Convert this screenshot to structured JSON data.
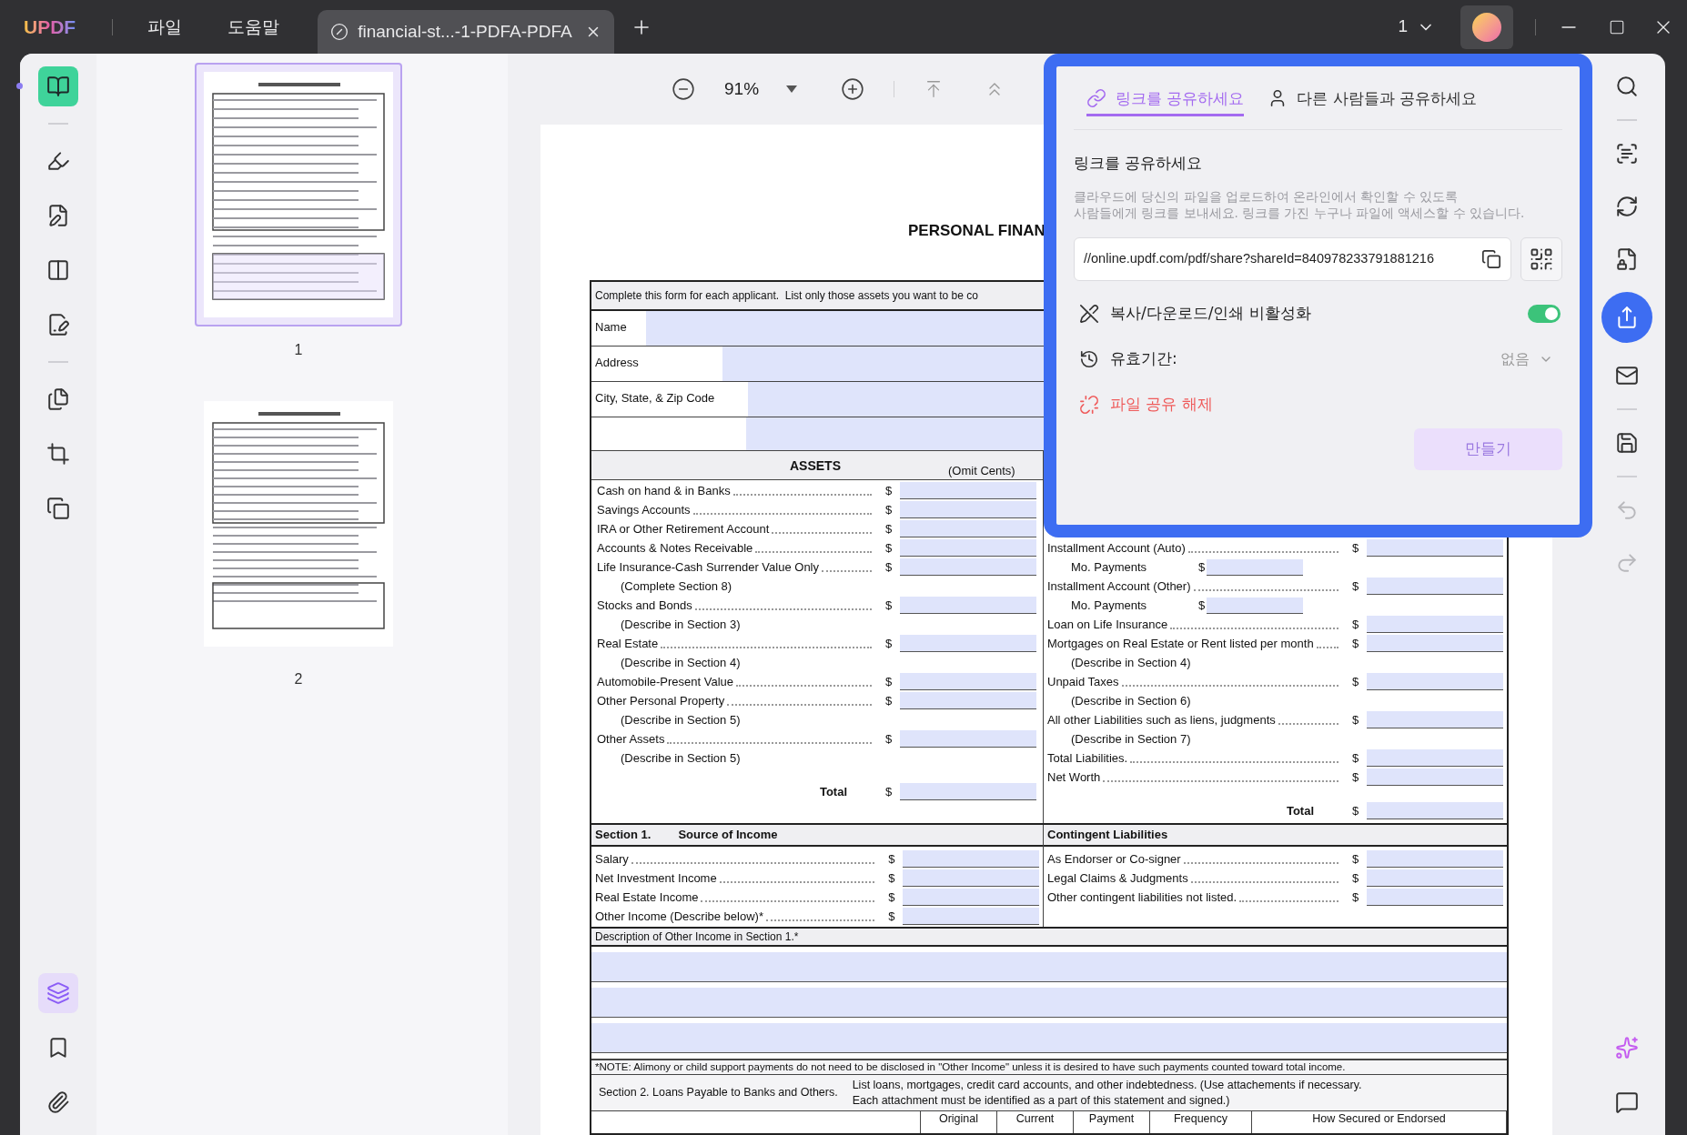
{
  "app": {
    "logo": "UPDF",
    "menus": [
      "파일",
      "도움말"
    ]
  },
  "document_tab": {
    "title": "financial-st...-1-PDFA-PDFA",
    "selected": true
  },
  "page_indicator": "1",
  "left_tool_groups": [
    [
      {
        "kind": "read",
        "selected": true
      }
    ],
    [
      {
        "kind": "comment",
        "selected": false
      },
      {
        "kind": "edit",
        "selected": false
      },
      {
        "kind": "organize",
        "selected": false
      },
      {
        "kind": "sign",
        "selected": false
      }
    ],
    [
      {
        "kind": "pages",
        "selected": false
      },
      {
        "kind": "crop",
        "selected": false
      },
      {
        "kind": "copy",
        "selected": false
      }
    ]
  ],
  "left_bottom_tools": [
    {
      "kind": "layers",
      "selected": true
    },
    {
      "kind": "bookmark",
      "selected": false
    },
    {
      "kind": "attachment",
      "selected": false
    }
  ],
  "thumbnails": [
    {
      "label": "1",
      "selected": true
    },
    {
      "label": "2",
      "selected": false
    }
  ],
  "toolbar": {
    "zoom": "91%"
  },
  "form": {
    "title": "PERSONAL FINAN",
    "intro": "Complete this form for each applicant.  List only those assets you want to be co",
    "identity_rows": [
      {
        "label": "Name"
      },
      {
        "label": "Address"
      },
      {
        "label": "City, State, & Zip Code"
      }
    ],
    "assets_header": "ASSETS",
    "omit_note": "(Omit Cents)",
    "assets": [
      {
        "kind": "line",
        "label": "Cash on hand & in Banks",
        "currency": "$"
      },
      {
        "kind": "line",
        "label": "Savings Accounts",
        "currency": "$"
      },
      {
        "kind": "line",
        "label": "IRA or Other Retirement Account",
        "currency": "$"
      },
      {
        "kind": "line",
        "label": "Accounts & Notes Receivable",
        "currency": "$"
      },
      {
        "kind": "line",
        "label": "Life Insurance-Cash Surrender Value Only",
        "sub": "(Complete Section 8)",
        "currency": "$"
      },
      {
        "kind": "line",
        "label": "Stocks and Bonds",
        "sub": "(Describe in Section 3)",
        "currency": "$"
      },
      {
        "kind": "line",
        "label": "Real Estate",
        "sub": "(Describe in Section 4)",
        "currency": "$"
      },
      {
        "kind": "line",
        "label": "Automobile-Present Value",
        "currency": "$"
      },
      {
        "kind": "line",
        "label": "Other Personal Property",
        "sub": "(Describe in Section 5)",
        "currency": "$"
      },
      {
        "kind": "line",
        "label": "Other Assets",
        "sub": "(Describe in Section 5)",
        "currency": "$"
      },
      {
        "kind": "total",
        "label": "Total",
        "currency": "$"
      }
    ],
    "liabilities": [
      {
        "kind": "line",
        "label": "Installment Account (Auto)",
        "currency": "$"
      },
      {
        "kind": "payment",
        "label": "Mo. Payments",
        "currency": "$"
      },
      {
        "kind": "line",
        "label": "Installment Account (Other)",
        "currency": "$"
      },
      {
        "kind": "payment",
        "label": "Mo. Payments",
        "currency": "$"
      },
      {
        "kind": "line",
        "label": "Loan on Life Insurance",
        "currency": "$"
      },
      {
        "kind": "line",
        "label": "Mortgages on Real Estate or Rent listed per month",
        "sub": "(Describe in Section 4)",
        "currency": "$"
      },
      {
        "kind": "line",
        "label": "Unpaid Taxes",
        "sub": "(Describe in Section 6)",
        "currency": "$"
      },
      {
        "kind": "line",
        "label": "All other Liabilities such as liens, judgments",
        "sub": "(Describe in Section 7)",
        "currency": "$"
      },
      {
        "kind": "line",
        "label": "Total Liabilities.",
        "currency": "$"
      },
      {
        "kind": "line",
        "label": "Net Worth",
        "currency": "$"
      },
      {
        "kind": "total",
        "label": "Total",
        "currency": "$"
      }
    ],
    "income_header": {
      "number": "Section 1.",
      "title": "Source of Income"
    },
    "income": [
      {
        "kind": "line",
        "label": "Salary",
        "currency": "$"
      },
      {
        "kind": "line",
        "label": "Net Investment Income",
        "currency": "$"
      },
      {
        "kind": "line",
        "label": "Real Estate Income",
        "currency": "$"
      },
      {
        "kind": "line",
        "label": "Other Income (Describe below)*",
        "currency": "$"
      }
    ],
    "contingent_header": "Contingent Liabilities",
    "contingent": [
      {
        "kind": "line",
        "label": "As Endorser or Co-signer",
        "currency": "$"
      },
      {
        "kind": "line",
        "label": "Legal Claims & Judgments",
        "currency": "$"
      },
      {
        "kind": "line",
        "label": "Other contingent liabilities not listed.",
        "currency": "$"
      }
    ],
    "description_label": "Description of Other Income in Section 1.*",
    "note": "*NOTE: Alimony or child support payments do not need to be disclosed in \"Other Income\" unless it is desired to have such payments counted toward total income.",
    "section2": {
      "title": "Section 2. Loans Payable to Banks and Others.",
      "lines": [
        "List loans, mortgages, credit card accounts, and other indebtedness. (Use attachements if necessary.",
        "Each attachment must be identified as a part of this statement and signed.)"
      ]
    },
    "loan_columns": [
      "Original",
      "Current",
      "Payment",
      "Frequency",
      "How Secured or Endorsed"
    ]
  },
  "share_dialog": {
    "tabs": [
      {
        "label": "링크를 공유하세요",
        "kind": "link",
        "selected": true
      },
      {
        "label": "다른 사람들과 공유하세요",
        "kind": "people",
        "selected": false
      }
    ],
    "heading": "링크를 공유하세요",
    "description_lines": [
      "클라우드에 당신의 파일을 업로드하여 온라인에서 확인할 수 있도록",
      "사람들에게 링크를 보내세요. 링크를 가진 누구나 파일에 액세스할 수 있습니다."
    ],
    "link": "//online.updf.com/pdf/share?shareId=840978233791881216",
    "restrict": {
      "label": "복사/다운로드/인쇄 비활성화",
      "on": true
    },
    "expiry": {
      "label": "유효기간:",
      "value": "없음"
    },
    "unshare": "파일 공유 해제",
    "create": {
      "label": "만들기",
      "disabled": true
    }
  },
  "right_tool_groups": [
    [
      {
        "kind": "search",
        "selected": false,
        "disabled": false
      }
    ],
    [
      {
        "kind": "ocr",
        "selected": false,
        "disabled": false
      },
      {
        "kind": "convert",
        "selected": false,
        "disabled": false
      },
      {
        "kind": "protect",
        "selected": false,
        "disabled": false
      },
      {
        "kind": "share",
        "selected": true,
        "disabled": false
      },
      {
        "kind": "email",
        "selected": false,
        "disabled": false
      }
    ],
    [
      {
        "kind": "save",
        "selected": false,
        "disabled": false
      }
    ],
    [
      {
        "kind": "undo",
        "selected": false,
        "disabled": true
      },
      {
        "kind": "redo",
        "selected": false,
        "disabled": true
      }
    ]
  ],
  "right_bottom_tools": [
    {
      "kind": "ai",
      "selected": false,
      "disabled": false
    },
    {
      "kind": "comments",
      "selected": false,
      "disabled": false
    }
  ]
}
